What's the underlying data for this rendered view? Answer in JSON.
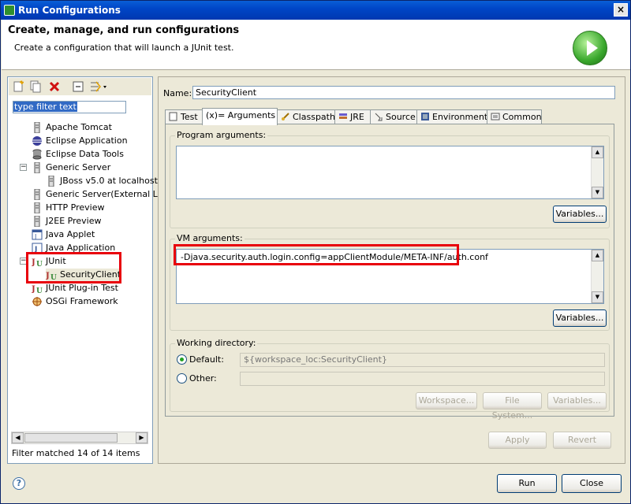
{
  "window": {
    "title": "Run Configurations",
    "close_glyph": "×"
  },
  "header": {
    "title": "Create, manage, and run configurations",
    "subtitle": "Create a configuration that will launch a JUnit test."
  },
  "left_panel": {
    "filter_placeholder": "type filter text",
    "tree": [
      {
        "label": "Apache Tomcat",
        "icon": "server-icon"
      },
      {
        "label": "Eclipse Application",
        "icon": "eclipse-icon"
      },
      {
        "label": "Eclipse Data Tools",
        "icon": "database-icon"
      },
      {
        "label": "Generic Server",
        "icon": "server-icon",
        "expanded": true
      },
      {
        "label": "JBoss v5.0 at localhost",
        "icon": "server-icon",
        "child": true
      },
      {
        "label": "Generic Server(External La",
        "icon": "server-icon"
      },
      {
        "label": "HTTP Preview",
        "icon": "server-icon"
      },
      {
        "label": "J2EE Preview",
        "icon": "server-icon"
      },
      {
        "label": "Java Applet",
        "icon": "java-applet-icon"
      },
      {
        "label": "Java Application",
        "icon": "java-app-icon"
      },
      {
        "label": "JUnit",
        "icon": "junit-icon",
        "expanded": true
      },
      {
        "label": "SecurityClient",
        "icon": "junit-icon",
        "child": true,
        "selected": true
      },
      {
        "label": "JUnit Plug-in Test",
        "icon": "junit-icon"
      },
      {
        "label": "OSGi Framework",
        "icon": "osgi-icon"
      }
    ],
    "status": "Filter matched 14 of 14 items"
  },
  "config": {
    "name_label": "Name:",
    "name_value": "SecurityClient",
    "tabs": [
      {
        "label": "Test",
        "icon": "test-tab-icon"
      },
      {
        "label": "(x)= Arguments",
        "icon": "arguments-tab-icon",
        "active": true
      },
      {
        "label": "Classpath",
        "icon": "classpath-tab-icon"
      },
      {
        "label": "JRE",
        "icon": "jre-tab-icon"
      },
      {
        "label": "Source",
        "icon": "source-tab-icon"
      },
      {
        "label": "Environment",
        "icon": "environment-tab-icon"
      },
      {
        "label": "Common",
        "icon": "common-tab-icon"
      }
    ],
    "program_args_label": "Program arguments:",
    "program_args_value": "",
    "variables_label": "Variables...",
    "vm_args_label": "VM arguments:",
    "vm_args_value": "-Djava.security.auth.login.config=appClientModule/META-INF/auth.conf",
    "working_dir_label": "Working directory:",
    "default_label": "Default:",
    "default_value": "${workspace_loc:SecurityClient}",
    "other_label": "Other:",
    "other_value": "",
    "workspace_button": "Workspace...",
    "filesystem_button": "File System...",
    "variables3_button": "Variables..."
  },
  "footer": {
    "apply": "Apply",
    "revert": "Revert",
    "run": "Run",
    "close": "Close",
    "help": "?"
  },
  "colors": {
    "highlight_box": "#e8000b",
    "selection": "#316ac5",
    "title_bar": "#0046c7"
  }
}
